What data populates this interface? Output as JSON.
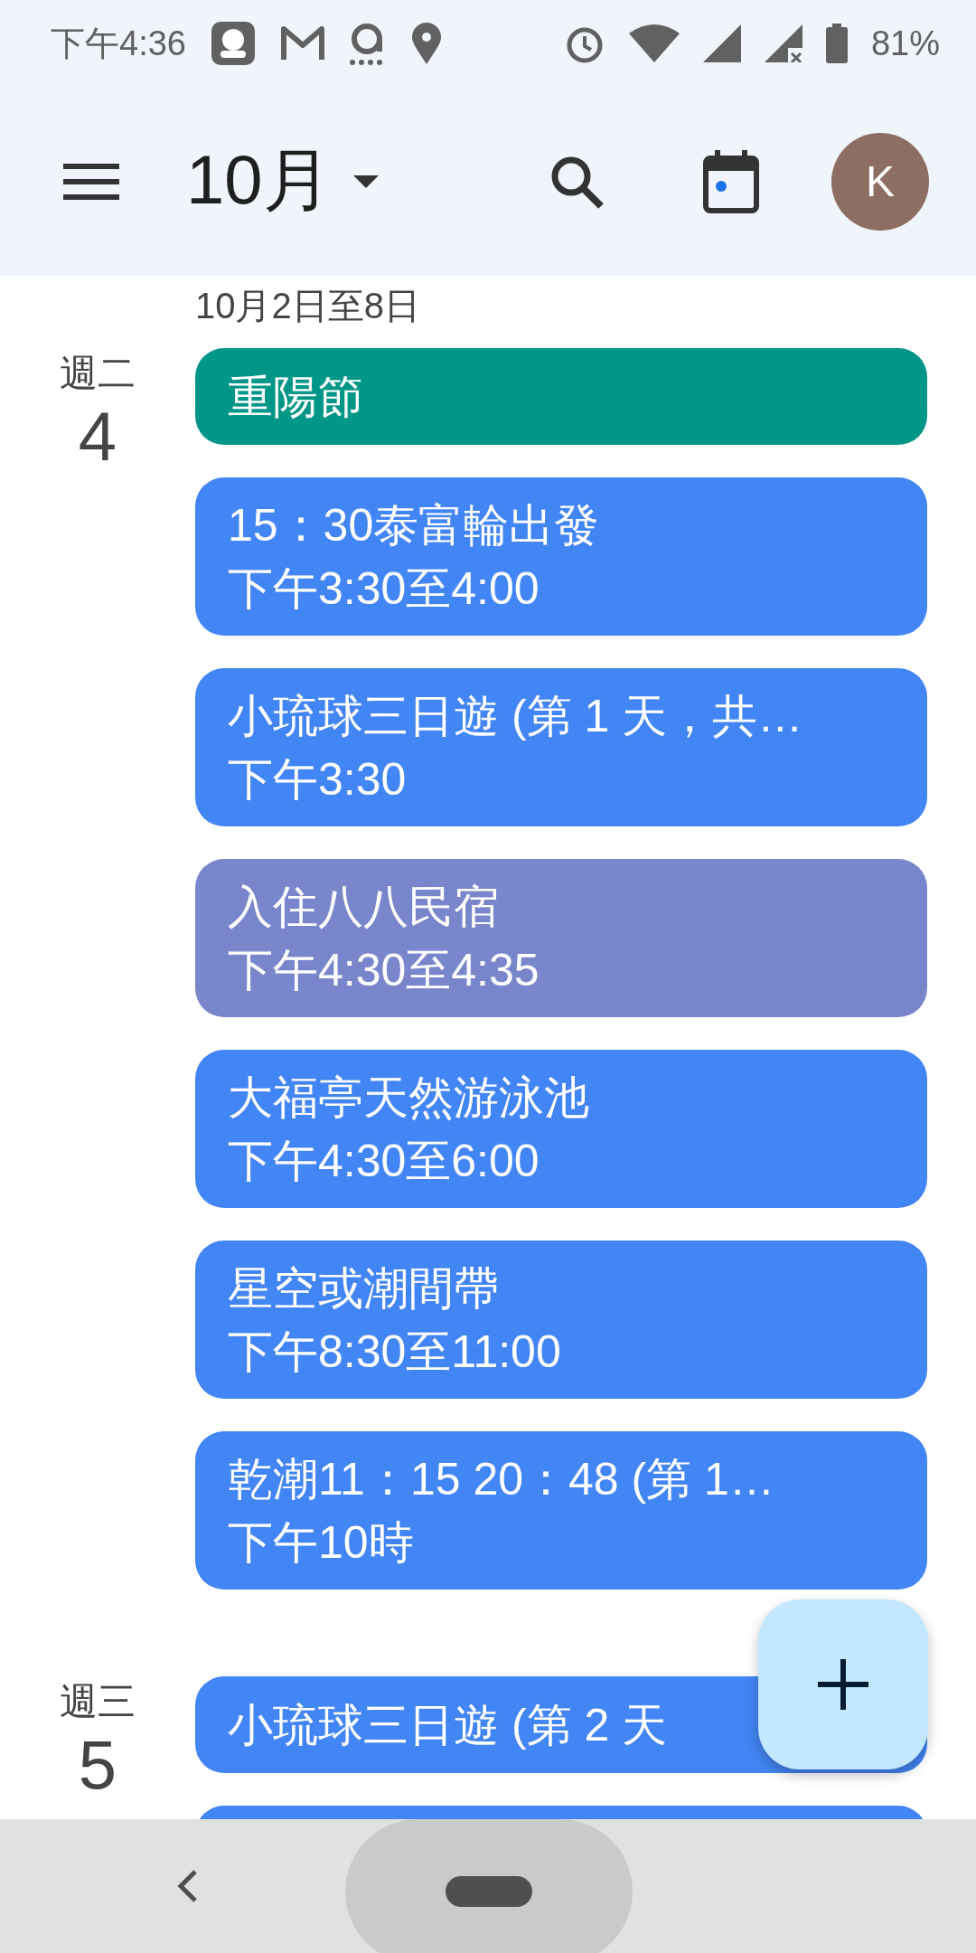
{
  "status_bar": {
    "time": "下午4:36",
    "battery": "81%"
  },
  "header": {
    "month": "10月",
    "avatar_letter": "K"
  },
  "week_range": "10月2日至8日",
  "days": [
    {
      "weekday": "週二",
      "date": "4",
      "events": [
        {
          "title": "重陽節",
          "color": "#009688"
        },
        {
          "title": "15：30泰富輪出發",
          "time": "下午3:30至4:00",
          "color": "#4285f4"
        },
        {
          "title": "小琉球三日遊 (第 1 天，共…",
          "time": "下午3:30",
          "color": "#4285f4"
        },
        {
          "title": "入住八八民宿",
          "time": "下午4:30至4:35",
          "color": "#7986cb"
        },
        {
          "title": "大福亭天然游泳池",
          "time": "下午4:30至6:00",
          "color": "#4285f4"
        },
        {
          "title": "星空或潮間帶",
          "time": "下午8:30至11:00",
          "color": "#4285f4"
        },
        {
          "title": "乾潮11：15 20：48 (第 1…",
          "time": "下午10時",
          "color": "#4285f4"
        }
      ]
    },
    {
      "weekday": "週三",
      "date": "5",
      "events": [
        {
          "title": "小琉球三日遊 (第 2 天",
          "color": "#4285f4"
        },
        {
          "color": "#4285f4"
        }
      ]
    }
  ]
}
